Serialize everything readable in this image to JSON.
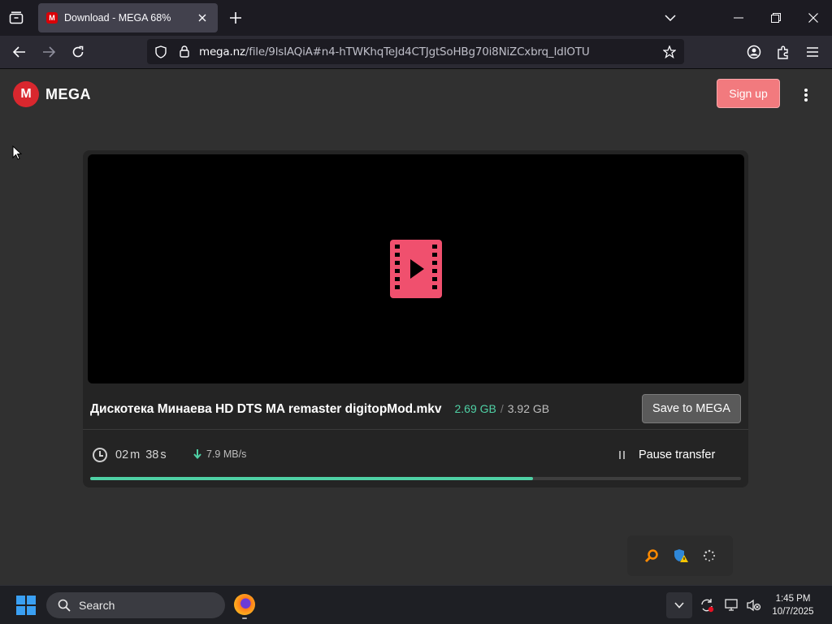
{
  "browser": {
    "tab": {
      "title": "Download - MEGA 68%",
      "favicon_letter": "M"
    },
    "url": {
      "host": "mega.nz",
      "path": "/file/9lsIAQiA#n4-hTWKhqTeJd4CTJgtSoHBg70i8NiZCxbrq_IdIOTU"
    }
  },
  "header": {
    "logo_letter": "M",
    "logo_text": "MEGA",
    "signup_label": "Sign up"
  },
  "download": {
    "file_name": "Дискотека Минаева HD DTS MA remaster digitopMod.mkv",
    "downloaded": "2.69 GB",
    "separator": "/",
    "total": "3.92 GB",
    "save_label": "Save to MEGA",
    "time_minutes": "02",
    "time_minutes_unit": "m",
    "time_seconds": "38",
    "time_seconds_unit": "s",
    "speed": "7.9 MB/s",
    "pause_label": "Pause transfer",
    "progress_fraction": 0.68
  },
  "taskbar": {
    "search_label": "Search",
    "time": "1:45 PM",
    "date": "10/7/2025"
  },
  "colors": {
    "accent_green": "#4fd1a5",
    "mega_red": "#d9272e",
    "signup_bg": "#f27a7e",
    "video_icon": "#f0506e"
  },
  "icons": {
    "tab_list": "tab-list-icon",
    "close": "close-icon",
    "new_tab": "plus-icon",
    "back": "back-arrow-icon",
    "forward": "forward-arrow-icon",
    "reload": "reload-icon",
    "shield": "shield-icon",
    "lock": "lock-icon",
    "star": "star-icon",
    "account": "account-icon",
    "extensions": "puzzle-icon",
    "menu": "hamburger-icon",
    "video": "video-file-icon",
    "clock": "clock-icon",
    "download_arrow": "download-arrow-icon",
    "pause": "pause-icon"
  }
}
